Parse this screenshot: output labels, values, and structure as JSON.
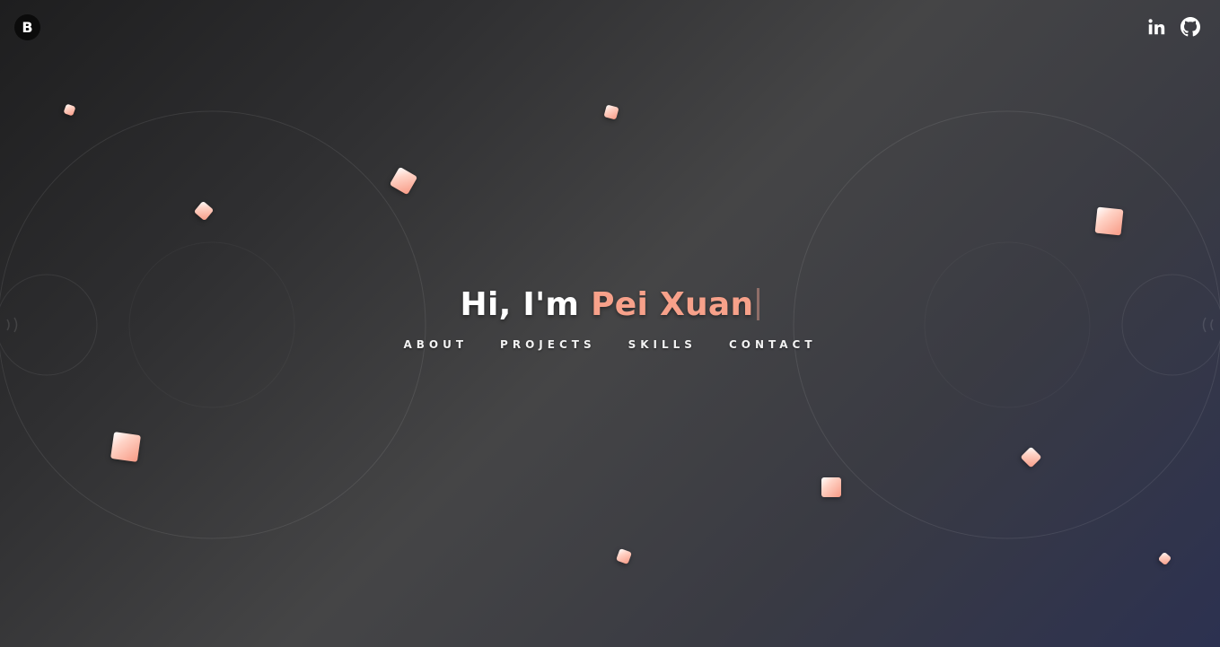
{
  "header": {
    "logo_letter": "B",
    "social": [
      {
        "name": "linkedin-icon"
      },
      {
        "name": "github-icon"
      }
    ]
  },
  "hero": {
    "greeting": "Hi, I'm",
    "name": "Pei Xuan"
  },
  "nav": {
    "items": [
      "ABOUT",
      "PROJECTS",
      "SKILLS",
      "CONTACT"
    ]
  },
  "colors": {
    "accent": "#f7a18a",
    "logo_bg": "#0b0b0b",
    "text": "#ffffff"
  }
}
